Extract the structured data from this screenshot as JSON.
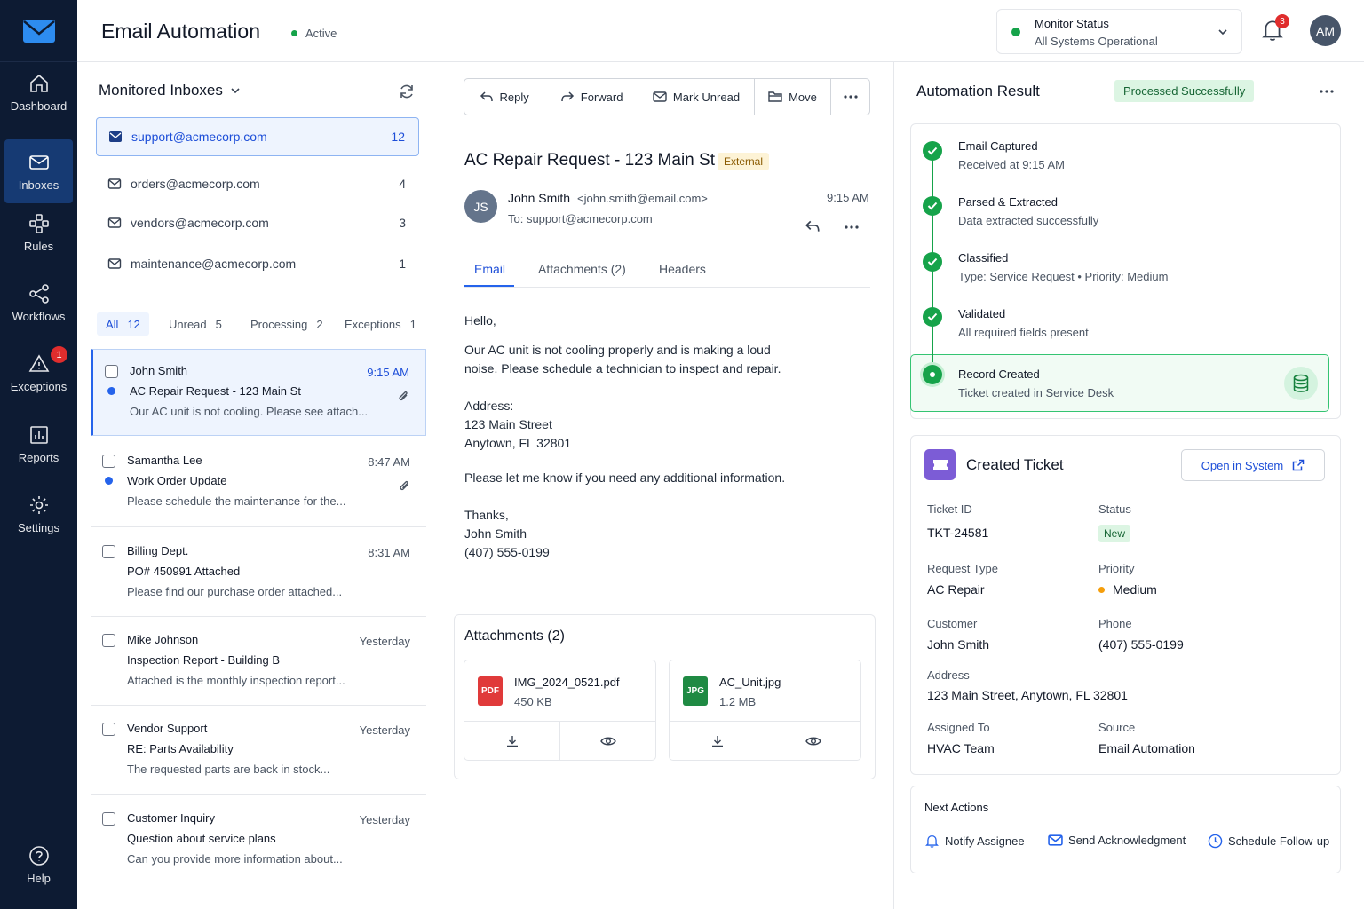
{
  "sidebar": {
    "items": [
      {
        "label": "Dashboard",
        "icon": "home-icon"
      },
      {
        "label": "Inboxes",
        "icon": "mail-icon"
      },
      {
        "label": "Rules",
        "icon": "rules-icon"
      },
      {
        "label": "Workflows",
        "icon": "workflow-icon"
      },
      {
        "label": "Exceptions",
        "icon": "warning-icon",
        "badge": "1"
      },
      {
        "label": "Reports",
        "icon": "chart-icon"
      },
      {
        "label": "Settings",
        "icon": "gear-icon"
      }
    ],
    "help": "Help",
    "colors": {
      "background": "#0d1b33",
      "active": "#163a73"
    }
  },
  "header": {
    "title": "Email Automation",
    "status": "Active",
    "monitor_title": "Monitor Status",
    "monitor_status": "All Systems Operational",
    "notification_count": "3",
    "user_initials": "AM"
  },
  "inboxes": {
    "title": "Monitored Inboxes",
    "list": [
      {
        "email": "support@acmecorp.com",
        "count": "12"
      },
      {
        "email": "orders@acmecorp.com",
        "count": "4"
      },
      {
        "email": "vendors@acmecorp.com",
        "count": "3"
      },
      {
        "email": "maintenance@acmecorp.com",
        "count": "1"
      }
    ],
    "filters": [
      {
        "label": "All",
        "count": "12"
      },
      {
        "label": "Unread",
        "count": "5"
      },
      {
        "label": "Processing",
        "count": "2"
      },
      {
        "label": "Exceptions",
        "count": "1"
      }
    ],
    "messages": [
      {
        "sender": "John Smith",
        "time": "9:15 AM",
        "subject": "AC Repair Request - 123 Main St",
        "preview": "Our AC unit is not cooling. Please see attach..."
      },
      {
        "sender": "Samantha Lee",
        "time": "8:47 AM",
        "subject": "Work Order Update",
        "preview": "Please schedule the maintenance for the..."
      },
      {
        "sender": "Billing Dept.",
        "time": "8:31 AM",
        "subject": "PO# 450991 Attached",
        "preview": "Please find our purchase order attached..."
      },
      {
        "sender": "Mike Johnson",
        "time": "Yesterday",
        "subject": "Inspection Report - Building B",
        "preview": "Attached is the monthly inspection report..."
      },
      {
        "sender": "Vendor Support",
        "time": "Yesterday",
        "subject": "RE: Parts Availability",
        "preview": "The requested parts are back in stock..."
      },
      {
        "sender": "Customer Inquiry",
        "time": "Yesterday",
        "subject": "Question about service plans",
        "preview": "Can you provide more information about..."
      }
    ]
  },
  "email": {
    "toolbar": {
      "reply": "Reply",
      "forward": "Forward",
      "mark_unread": "Mark Unread",
      "move": "Move"
    },
    "subject": "AC Repair Request - 123 Main St",
    "badge": "External",
    "sender_initials": "JS",
    "from_name": "John Smith",
    "from_email": "<john.smith@email.com>",
    "to": "To: support@acmecorp.com",
    "time": "9:15 AM",
    "tabs": [
      "Email",
      "Attachments (2)",
      "Headers"
    ],
    "body": {
      "greeting": "Hello,",
      "p1_line1": "Our AC unit is not cooling properly and is making a loud",
      "p1_line2": "noise. Please schedule a technician to inspect and repair.",
      "address_label": "Address:",
      "address_line1": "123 Main Street",
      "address_line2": "Anytown, FL 32801",
      "p2": "Please let me know if you need any additional information.",
      "thanks": "Thanks,",
      "name": "John Smith",
      "phone": "(407) 555-0199"
    },
    "attachments_title": "Attachments (2)",
    "attachments": [
      {
        "type": "PDF",
        "name": "IMG_2024_0521.pdf",
        "size": "450 KB",
        "color": "#e03a3a"
      },
      {
        "type": "JPG",
        "name": "AC_Unit.jpg",
        "size": "1.2 MB",
        "color": "#1f8a43"
      }
    ]
  },
  "automation": {
    "title": "Automation Result",
    "badge": "Processed Successfully",
    "steps": [
      {
        "title": "Email Captured",
        "sub": "Received at 9:15 AM"
      },
      {
        "title": "Parsed & Extracted",
        "sub": "Data extracted successfully"
      },
      {
        "title": "Classified",
        "sub": "Type: Service Request  •  Priority: Medium"
      },
      {
        "title": "Validated",
        "sub": "All required fields present"
      },
      {
        "title": "Record Created",
        "sub": "Ticket created in Service Desk"
      }
    ],
    "ticket": {
      "title": "Created Ticket",
      "open_label": "Open in System",
      "labels": {
        "id": "Ticket ID",
        "status": "Status",
        "request_type": "Request Type",
        "priority": "Priority",
        "customer": "Customer",
        "phone": "Phone",
        "address": "Address",
        "assigned": "Assigned To",
        "source": "Source"
      },
      "values": {
        "id": "TKT-24581",
        "status": "New",
        "request_type": "AC Repair",
        "priority": "Medium",
        "customer": "John Smith",
        "phone": "(407) 555-0199",
        "address": "123 Main Street, Anytown, FL 32801",
        "assigned": "HVAC Team",
        "source": "Email Automation"
      }
    },
    "next_actions": {
      "title": "Next Actions",
      "items": [
        "Notify Assignee",
        "Send Acknowledgment",
        "Schedule Follow-up"
      ]
    },
    "colors": {
      "success": "#16a34a",
      "accent": "#2563eb"
    }
  }
}
